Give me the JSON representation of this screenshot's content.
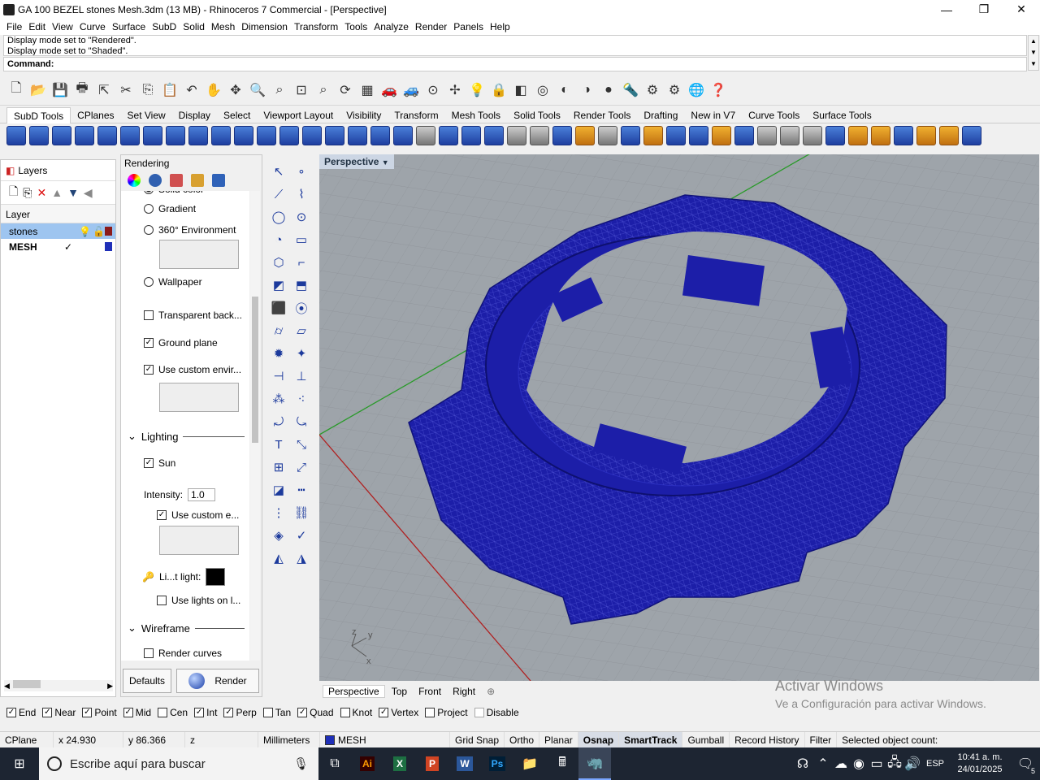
{
  "titlebar": {
    "title": "GA 100 BEZEL stones Mesh.3dm (13 MB) - Rhinoceros 7 Commercial - [Perspective]",
    "minimize": "—",
    "maximize": "❐",
    "close": "✕"
  },
  "menu": [
    "File",
    "Edit",
    "View",
    "Curve",
    "Surface",
    "SubD",
    "Solid",
    "Mesh",
    "Dimension",
    "Transform",
    "Tools",
    "Analyze",
    "Render",
    "Panels",
    "Help"
  ],
  "command": {
    "history1": "Display mode set to \"Rendered\".",
    "history2": "Display mode set to \"Shaded\".",
    "prompt": "Command:"
  },
  "tabs": [
    "SubD Tools",
    "CPlanes",
    "Set View",
    "Display",
    "Select",
    "Viewport Layout",
    "Visibility",
    "Transform",
    "Mesh Tools",
    "Solid Tools",
    "Render Tools",
    "Drafting",
    "New in V7",
    "Curve Tools",
    "Surface Tools"
  ],
  "layers": {
    "panel_title": "Layers",
    "column": "Layer",
    "rows": [
      {
        "name": "stones",
        "color": "#8b1a1a"
      },
      {
        "name": "MESH",
        "color": "#1f2fb8"
      }
    ]
  },
  "rendering": {
    "panel_title": "Rendering",
    "solid_color": "Solid color",
    "gradient": "Gradient",
    "environment": "360° Environment",
    "wallpaper": "Wallpaper",
    "transparent": "Transparent back...",
    "ground_plane": "Ground plane",
    "custom_env": "Use custom envir...",
    "lighting": "Lighting",
    "sun": "Sun",
    "intensity_label": "Intensity:",
    "intensity_value": "1.0",
    "use_custom": "Use custom e...",
    "light_label": "Li...t light:",
    "use_lights": "Use lights on l...",
    "wireframe": "Wireframe",
    "render_curves": "Render curves",
    "defaults": "Defaults",
    "render": "Render"
  },
  "viewport": {
    "active": "Perspective",
    "tabs": [
      "Perspective",
      "Top",
      "Front",
      "Right"
    ],
    "add": "⊕",
    "axis_z": "z",
    "axis_y": "y",
    "axis_x": "x"
  },
  "watermark": {
    "line1": "Activar Windows",
    "line2": "Ve a Configuración para activar Windows."
  },
  "osnaps": [
    {
      "label": "End",
      "checked": true
    },
    {
      "label": "Near",
      "checked": true
    },
    {
      "label": "Point",
      "checked": true
    },
    {
      "label": "Mid",
      "checked": true
    },
    {
      "label": "Cen",
      "checked": false
    },
    {
      "label": "Int",
      "checked": true
    },
    {
      "label": "Perp",
      "checked": true
    },
    {
      "label": "Tan",
      "checked": false
    },
    {
      "label": "Quad",
      "checked": true
    },
    {
      "label": "Knot",
      "checked": false
    },
    {
      "label": "Vertex",
      "checked": true
    },
    {
      "label": "Project",
      "checked": false
    },
    {
      "label": "Disable",
      "checked": false
    }
  ],
  "status": {
    "cplane": "CPlane",
    "x": "x 24.930",
    "y": "y 86.366",
    "z": "z",
    "units": "Millimeters",
    "layer": "MESH",
    "buttons": [
      "Grid Snap",
      "Ortho",
      "Planar",
      "Osnap",
      "SmartTrack",
      "Gumball",
      "Record History",
      "Filter"
    ],
    "selected": "Selected object count:"
  },
  "taskbar": {
    "search": "Escribe aquí para buscar",
    "lang": "ESP",
    "time": "10:41 a. m.",
    "date": "24/01/2025",
    "notif": "5"
  },
  "colors": {
    "mesh": "#1c1ea8",
    "viewport": "#9ea4aa"
  }
}
